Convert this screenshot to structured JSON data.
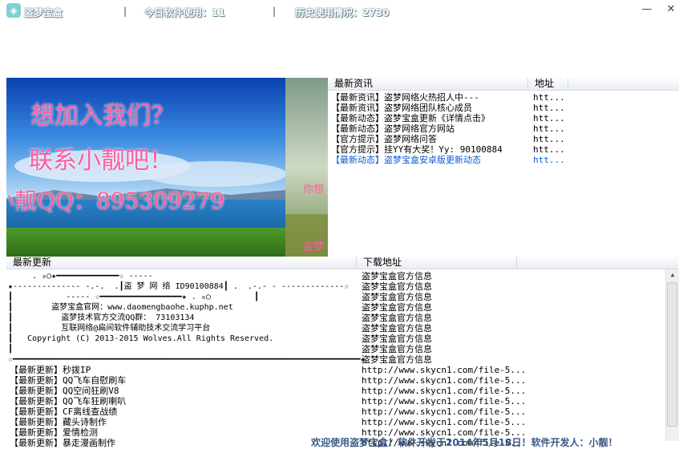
{
  "window": {
    "title": "盗梦宝盒",
    "today_usage": "今日软件使用：11",
    "history_usage": "历史使用情况：2730",
    "separator": "|",
    "minimize_icon": "—",
    "close_icon": "✕"
  },
  "banner": {
    "line1": "想加入我们？",
    "line2": "联系小靓吧！",
    "line3": "小靓QQ：895309279",
    "side_text": "你想",
    "side_text2": "盗梦"
  },
  "news": {
    "columns": [
      "最新资讯",
      "地址"
    ],
    "rows": [
      {
        "title": "【最新资讯】盗梦网络火热招人中---",
        "addr": "htt..."
      },
      {
        "title": "【最新资讯】盗梦网络团队核心成员",
        "addr": "htt..."
      },
      {
        "title": "【最新动态】盗梦宝盒更新《详情点击》",
        "addr": "htt..."
      },
      {
        "title": "【最新动态】盗梦网络官方网站",
        "addr": "htt..."
      },
      {
        "title": "【官方提示】盗梦网络问答",
        "addr": "htt..."
      },
      {
        "title": "【官方提示】挂YY有大奖！Yy: 90100884",
        "addr": "htt..."
      },
      {
        "title": "【最新动态】盗梦宝盒安卓版更新动态",
        "addr": "htt...",
        "highlight": true
      }
    ]
  },
  "updates": {
    "columns": [
      "最新更新",
      "下载地址"
    ],
    "art": [
      "     . ₀○★━━━━━━━━━━━━━☆ -----",
      "★-------------- -.-.  .┃盗 梦 网 络 ID90100884┃ .  .-.- - -------------☆",
      "┃           ----- ☆━━━━━━━━━━━━━━━━━★ . ₀○         ┃",
      "┃        盗梦宝盒官网：www.daomengbaohe.kuphp.net",
      "┃          盗梦技术官方交流QQ群： 73103134",
      "┃          互联网络@扁间软件辅助技术交流学习平台",
      "┃   Copyright (C) 2013-2015 Wolves.All Rights Reserved.",
      "┃",
      "☆━━━━━━━━━━━━━━━━━━━━━━━━━━━━━━━━━━━━━━━━━━━━━━━━━━━━━━━━━━━━━━━━━━━━━━━━★"
    ],
    "art_link": "盗梦宝盒官方信息",
    "items": [
      {
        "title": "【最新更新】秒拨IP",
        "url": "http://www.skycn1.com/file-5..."
      },
      {
        "title": "【最新更新】QQ飞车自慰刷车",
        "url": "http://www.skycn1.com/file-5..."
      },
      {
        "title": "【最新更新】QQ空间狂刷V8",
        "url": "http://www.skycn1.com/file-5..."
      },
      {
        "title": "【最新更新】QQ飞车狂刷喇叭",
        "url": "http://www.skycn1.com/file-5..."
      },
      {
        "title": "【最新更新】CF离线查战绩",
        "url": "http://www.skycn1.com/file-5..."
      },
      {
        "title": "【最新更新】藏头诗制作",
        "url": "http://www.skycn1.com/file-5..."
      },
      {
        "title": "【最新更新】爱情检测",
        "url": "http://www.skycn1.com/file-5..."
      },
      {
        "title": "【最新更新】暴走漫画制作",
        "url": "http://www.skycn1.com/file-5..."
      }
    ]
  },
  "footer": "欢迎使用盗梦宝盒！软件开发于2014年5月18日！软件开发人：小靓！"
}
